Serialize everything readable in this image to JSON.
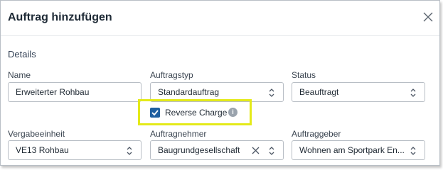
{
  "dialog": {
    "title": "Auftrag hinzufügen",
    "close_icon": "close-icon"
  },
  "section": {
    "title": "Details"
  },
  "fields": {
    "name": {
      "label": "Name",
      "value": "Erweiterter Rohbau"
    },
    "auftragstyp": {
      "label": "Auftragstyp",
      "value": "Standardauftrag"
    },
    "status": {
      "label": "Status",
      "value": "Beauftragt"
    },
    "vergabeeinheit": {
      "label": "Vergabeeinheit",
      "value": "VE13 Rohbau"
    },
    "auftragnehmer": {
      "label": "Auftragnehmer",
      "value": "Baugrundgesellschaft"
    },
    "auftraggeber": {
      "label": "Auftraggeber",
      "value": "Wohnen am Sportpark En..."
    }
  },
  "reverse_charge": {
    "label": "Reverse Charge",
    "checked": true,
    "info_icon": "info-icon"
  },
  "colors": {
    "checkbox_accent": "#1f5fa0",
    "highlight": "#e4ea19"
  }
}
